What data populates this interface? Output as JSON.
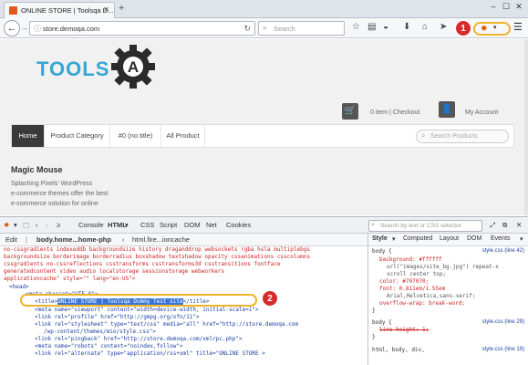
{
  "browser": {
    "tab_title": "ONLINE STORE | Toolsqa D...",
    "new_tab": "+",
    "url": "store.demoqa.com",
    "search_placeholder": "Search",
    "window_min": "–",
    "window_max": "☐",
    "window_close": "✕"
  },
  "annotations": {
    "one": "1",
    "two": "2",
    "accent": "#d62b2b",
    "highlight": "#f0b429"
  },
  "site": {
    "logo_text": "TOOLS",
    "logo_letter": "A",
    "cart_text": "0 item | Checkout",
    "account_text": "My Account",
    "menu": [
      "Home",
      "Product Category",
      "#0 (no title)",
      "All Product"
    ],
    "search_placeholder": "Search Products",
    "heading": "Magic Mouse",
    "desc_lines": [
      "Splashing Pixels' WordPress",
      "e-commerce themes offer the best",
      "e-commerce solution for online"
    ]
  },
  "firebug": {
    "toolbar": [
      "Console",
      "HTML",
      "CSS",
      "Script",
      "DOM",
      "Net",
      "Cookies"
    ],
    "edit": "Edit",
    "breadcrumbs": [
      "body.home...home-php",
      "html.fire...ioncache"
    ],
    "search_placeholder": "Search by text or CSS selector",
    "style_tabs": [
      "Style",
      "Computed",
      "Layout",
      "DOM",
      "Events"
    ],
    "html_lines": [
      "no-cssgradients indexeddb backgroundsize history draganddrop websockets rgba hsla multiplebgs",
      "backgroundsize borderimage borderradius boxshadow textshadow opacity cssanimations csscolumns",
      "cssgradients no-cssreflections csstransforms csstransforms3d csstransitions fontface",
      "generatedcontent video audio localstorage sessionstorage webworkers",
      "applicationcache\" style=\"\" lang=\"en-US\">",
      "<head>",
      "<meta charset=\"UTF-8\">",
      "ONLINE STORE | Toolsqa Dummy Test site",
      "<meta name=\"viewport\" content=\"width=device-width, initial-scale=1\">",
      "<link rel=\"profile\" href=\"http://gmpg.org/xfn/11\">",
      "<link rel=\"stylesheet\" type=\"text/css\" media=\"all\" href=\"http://store.demoqa.com",
      "/wp-content/themes/mio/style.css\">",
      "<link rel=\"pingback\" href=\"http://store.demoqa.com/xmlrpc.php\">",
      "<meta name=\"robots\" content=\"noindex,follow\">",
      "<link rel=\"alternate\" type=\"application/rss+xml\" title=\"ONLINE STORE >"
    ],
    "title_open": "<title>",
    "title_close": "</title>",
    "style_lines": [
      "body {",
      "background: #ffffff",
      "url(\"images/site_bg.jpg\") repeat-x",
      "scroll center top;",
      "color: #707070;",
      "font: 0.811em/1.55em",
      "Arial,Helvetica,sans-serif;",
      "overflow-wrap: break-word;",
      "}",
      "body {",
      "line-height: 1;",
      "}",
      "html, body, div,"
    ],
    "style_refs": [
      "style.css (line 42)",
      "style.css (line 29)",
      "style.css (line 19)"
    ]
  }
}
